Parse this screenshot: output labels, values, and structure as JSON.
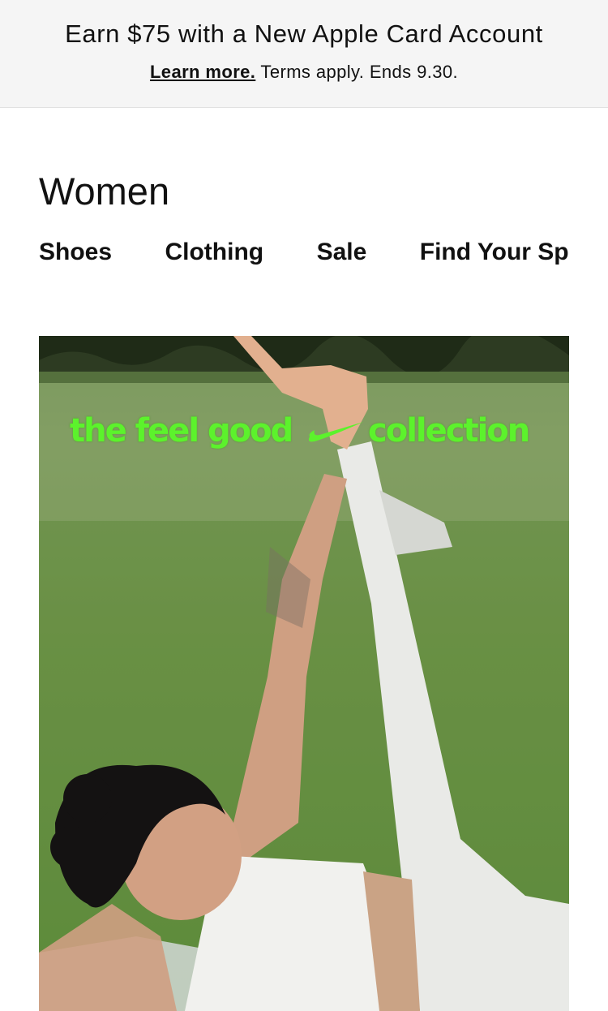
{
  "promo": {
    "title": "Earn $75 with a New Apple Card Account",
    "link_label": "Learn more.",
    "terms": " Terms apply. Ends 9.30."
  },
  "page": {
    "title": "Women"
  },
  "subnav": {
    "items": [
      {
        "label": "Shoes"
      },
      {
        "label": "Clothing"
      },
      {
        "label": "Sale"
      },
      {
        "label": "Find Your Sp"
      }
    ]
  },
  "hero": {
    "tagline_left": "the feel good",
    "tagline_right": "collection",
    "logo": "swoosh-icon",
    "accent_color": "#5cf22c"
  }
}
